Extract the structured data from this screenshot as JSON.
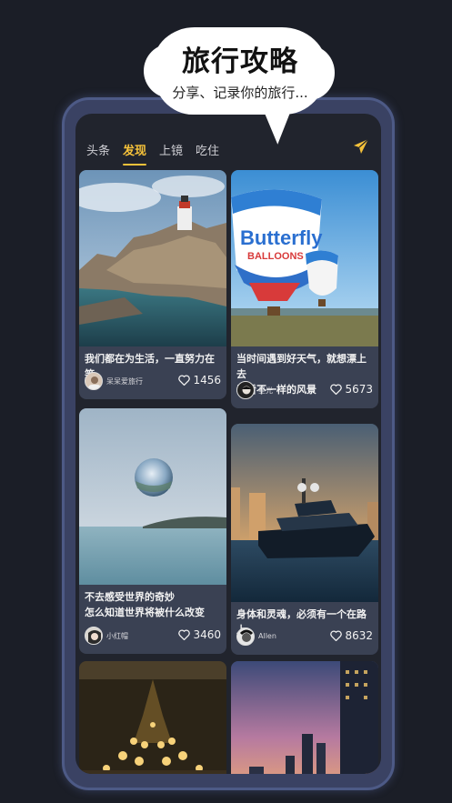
{
  "banner": {
    "title": "旅行攻略",
    "subtitle": "分享、记录你的旅行..."
  },
  "tabs": [
    {
      "label": "头条",
      "active": false
    },
    {
      "label": "发现",
      "active": true
    },
    {
      "label": "上镜",
      "active": false
    },
    {
      "label": "吃住",
      "active": false
    }
  ],
  "accent_color": "#f6c23a",
  "icons": {
    "send": "paper-plane-icon",
    "like": "heart-icon"
  },
  "cards": [
    {
      "caption": "我们都在为生活，一直努力在笑",
      "user": "呆呆爱旅行",
      "likes": "1456",
      "image": "lighthouse-rocks-sea"
    },
    {
      "caption": "当时间遇到好天气，就想漂上去\n看看不一样的风景",
      "user": "星光",
      "likes": "5673",
      "image": "hot-air-balloons-butterfly"
    },
    {
      "caption": "不去感受世界的奇妙\n怎么知道世界将被什么改变",
      "user": "小红帽",
      "likes": "3460",
      "image": "crystal-ball-sea"
    },
    {
      "caption": "身体和灵魂，必须有一个在路上",
      "user": "Allen",
      "likes": "8632",
      "image": "yacht-harbor-sunset"
    },
    {
      "caption": "",
      "user": "",
      "likes": "",
      "image": "chandelier"
    },
    {
      "caption": "",
      "user": "",
      "likes": "",
      "image": "city-skyline-dusk"
    }
  ],
  "balloon_text": {
    "brand": "Butterfly",
    "sub": "BALLOONS"
  }
}
